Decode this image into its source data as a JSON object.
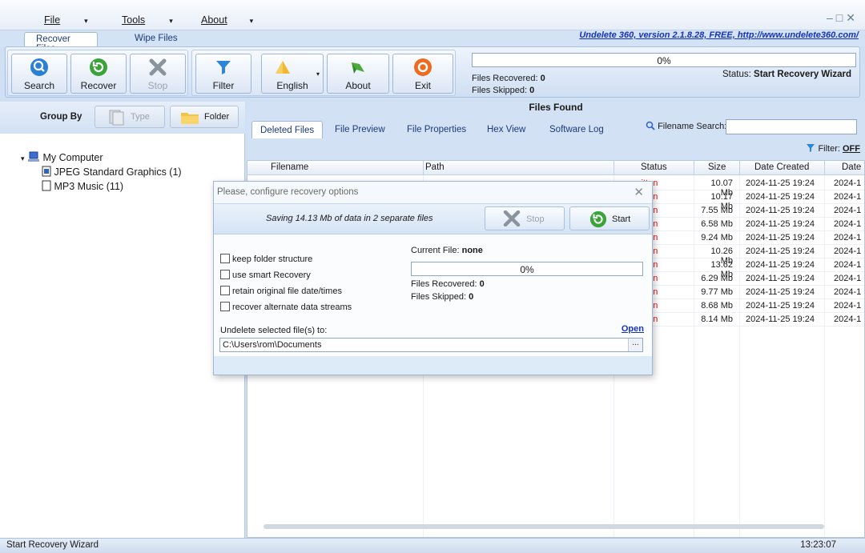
{
  "menu": {
    "file": "File",
    "tools": "Tools",
    "about": "About"
  },
  "top_tabs": [
    "Recover Files",
    "Wipe Files"
  ],
  "version_link": "Undelete 360, version 2.1.8.28, FREE, http://www.undelete360.com/",
  "toolbar": {
    "search": "Search",
    "recover": "Recover",
    "stop": "Stop",
    "filter": "Filter",
    "language": "English",
    "about": "About",
    "exit": "Exit"
  },
  "status": {
    "progress": "0%",
    "files_recovered_label": "Files Recovered:",
    "files_recovered": "0",
    "files_skipped_label": "Files Skipped:",
    "files_skipped": "0",
    "status_label": "Status:",
    "status_value": "Start Recovery Wizard"
  },
  "group_by": {
    "label": "Group By",
    "type": "Type",
    "folder": "Folder"
  },
  "tree": {
    "root": "My Computer",
    "items": [
      "JPEG Standard Graphics (1)",
      "MP3 Music (11)"
    ]
  },
  "files_found": "Files Found",
  "right_tabs": [
    "Deleted Files",
    "File Preview",
    "File Properties",
    "Hex View",
    "Software Log"
  ],
  "filename_search_label": "Filename Search:",
  "filter_label": "Filter:",
  "filter_value": "OFF",
  "columns": [
    "Filename",
    "Path",
    "Status",
    "Size",
    "Date Created",
    "Date"
  ],
  "rows": [
    {
      "status": "written",
      "size": "10.07 Mb",
      "created": "2024-11-25 19:24",
      "date": "2024-1"
    },
    {
      "status": "written",
      "size": "10.17 Mb",
      "created": "2024-11-25 19:24",
      "date": "2024-1"
    },
    {
      "status": "written",
      "size": "7.55 Mb",
      "created": "2024-11-25 19:24",
      "date": "2024-1"
    },
    {
      "status": "written",
      "size": "6.58 Mb",
      "created": "2024-11-25 19:24",
      "date": "2024-1"
    },
    {
      "status": "written",
      "size": "9.24 Mb",
      "created": "2024-11-25 19:24",
      "date": "2024-1"
    },
    {
      "status": "written",
      "size": "10.26 Mb",
      "created": "2024-11-25 19:24",
      "date": "2024-1"
    },
    {
      "status": "written",
      "size": "13.62 Mb",
      "created": "2024-11-25 19:24",
      "date": "2024-1"
    },
    {
      "status": "written",
      "size": "6.29 Mb",
      "created": "2024-11-25 19:24",
      "date": "2024-1"
    },
    {
      "status": "written",
      "size": "9.77 Mb",
      "created": "2024-11-25 19:24",
      "date": "2024-1"
    },
    {
      "status": "written",
      "size": "8.68 Mb",
      "created": "2024-11-25 19:24",
      "date": "2024-1"
    },
    {
      "status": "written",
      "size": "8.14 Mb",
      "created": "2024-11-25 19:24",
      "date": "2024-1"
    }
  ],
  "dialog": {
    "title": "Please, configure recovery options",
    "saving_text": "Saving 14.13 Mb of data in 2 separate files",
    "stop": "Stop",
    "start": "Start",
    "options": [
      "keep folder structure",
      "use smart Recovery",
      "retain original file date/times",
      "recover alternate data streams"
    ],
    "current_file_label": "Current File:",
    "current_file": "none",
    "progress": "0%",
    "files_recovered_label": "Files Recovered:",
    "files_recovered": "0",
    "files_skipped_label": "Files Skipped:",
    "files_skipped": "0",
    "undelete_to_label": "Undelete selected file(s) to:",
    "open_link": "Open",
    "path_value": "C:\\Users\\rom\\Documents",
    "browse": "..."
  },
  "statusbar": {
    "left": "Start Recovery Wizard",
    "time": "13:23:07"
  },
  "colors": {
    "accent": "#1533b8",
    "status_red": "#e01010"
  }
}
